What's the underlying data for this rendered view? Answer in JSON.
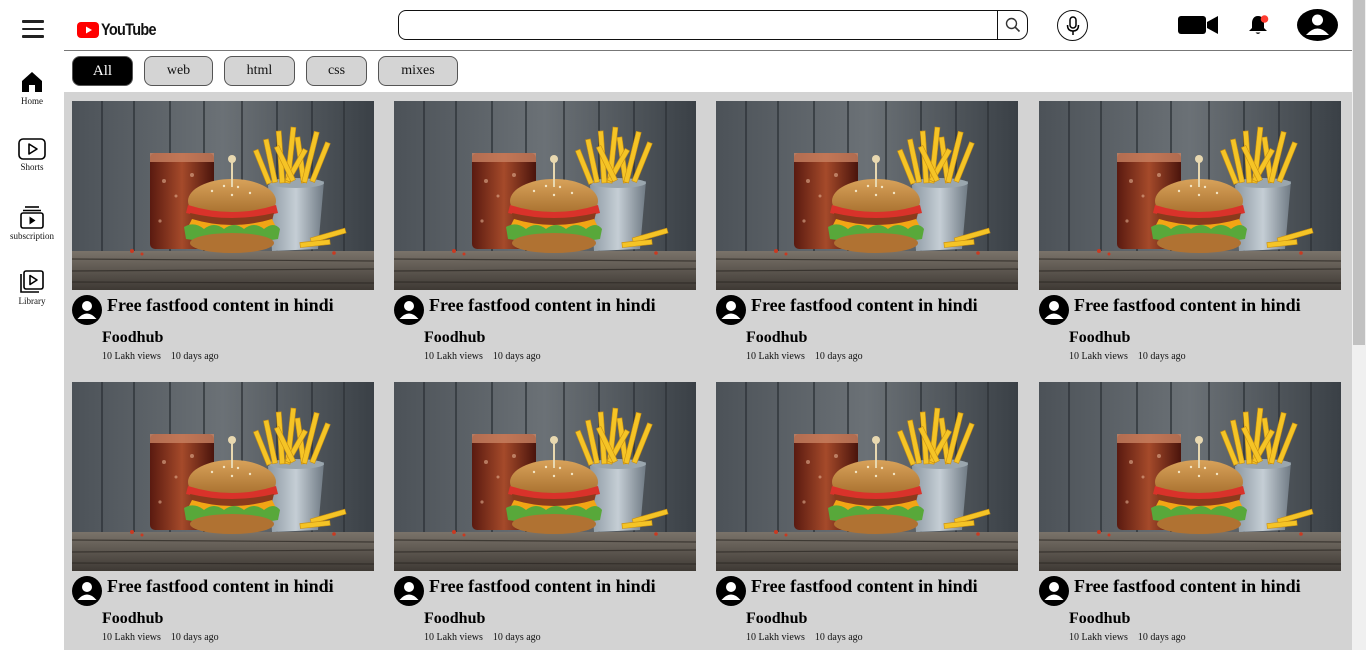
{
  "brand": {
    "name": "YouTube"
  },
  "sidebar": {
    "items": [
      {
        "label": "Home",
        "icon": "home-icon"
      },
      {
        "label": "Shorts",
        "icon": "shorts-icon"
      },
      {
        "label": "subscription",
        "icon": "subscription-icon"
      },
      {
        "label": "Library",
        "icon": "library-icon"
      }
    ]
  },
  "search": {
    "placeholder": "",
    "value": ""
  },
  "chips": [
    "All",
    "web",
    "html",
    "css",
    "mixes"
  ],
  "videos": [
    {
      "title": "Free fastfood content in hindi",
      "channel": "Foodhub",
      "views": "10 Lakh views",
      "age": "10 days ago"
    },
    {
      "title": "Free fastfood content in hindi",
      "channel": "Foodhub",
      "views": "10 Lakh views",
      "age": "10 days ago"
    },
    {
      "title": "Free fastfood content in hindi",
      "channel": "Foodhub",
      "views": "10 Lakh views",
      "age": "10 days ago"
    },
    {
      "title": "Free fastfood content in hindi",
      "channel": "Foodhub",
      "views": "10 Lakh views",
      "age": "10 days ago"
    },
    {
      "title": "Free fastfood content in hindi",
      "channel": "Foodhub",
      "views": "10 Lakh views",
      "age": "10 days ago"
    },
    {
      "title": "Free fastfood content in hindi",
      "channel": "Foodhub",
      "views": "10 Lakh views",
      "age": "10 days ago"
    },
    {
      "title": "Free fastfood content in hindi",
      "channel": "Foodhub",
      "views": "10 Lakh views",
      "age": "10 days ago"
    },
    {
      "title": "Free fastfood content in hindi",
      "channel": "Foodhub",
      "views": "10 Lakh views",
      "age": "10 days ago"
    }
  ],
  "colors": {
    "brand_red": "#ff0000",
    "content_bg": "#d3d3d3",
    "chip_bg": "#d4d4d4",
    "chip_active": "#000000"
  }
}
